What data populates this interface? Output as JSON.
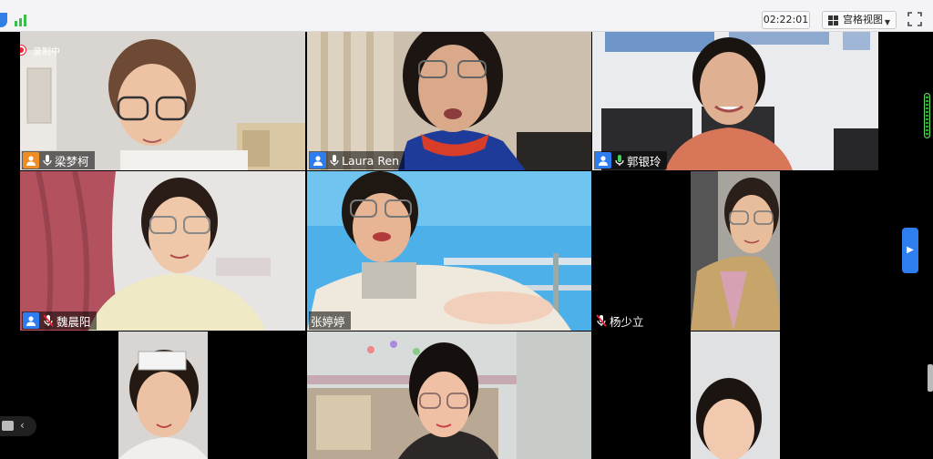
{
  "toolbar": {
    "timer": "02:22:01",
    "view_label": "宫格视图",
    "view_caret": "▼"
  },
  "recording": {
    "label": "录制中"
  },
  "participants": [
    {
      "name": "梁梦柯",
      "badge": "orange",
      "audio": "mic"
    },
    {
      "name": "Laura Ren",
      "badge": "blue",
      "audio": "mic"
    },
    {
      "name": "郭银玲",
      "badge": "blue",
      "audio": "mic-active",
      "speaking": true
    },
    {
      "name": "魏晨阳",
      "badge": "blue",
      "audio": "muted"
    },
    {
      "name": "张婷婷",
      "badge": "none",
      "audio": "none"
    },
    {
      "name": "杨少立",
      "badge": "none",
      "audio": "muted"
    },
    {
      "name": "",
      "badge": "none",
      "audio": "none"
    },
    {
      "name": "",
      "badge": "none",
      "audio": "none"
    },
    {
      "name": "",
      "badge": "none",
      "audio": "none"
    }
  ],
  "colors": {
    "accent": "#2e7ef0",
    "speaking_border": "#3fd158",
    "badge_orange": "#f08c24",
    "badge_blue": "#2d7cf0",
    "recording_dot": "#e22233"
  },
  "icons": {
    "signal": "signal-bars-icon",
    "grid_view": "grid-view-icon",
    "fullscreen": "fullscreen-icon",
    "next_page": "chevron-right-icon",
    "chat": "chat-icon",
    "collapse": "chevron-left-icon"
  },
  "nav": {
    "next_arrow": "▶",
    "collapse_arrow": "‹"
  }
}
